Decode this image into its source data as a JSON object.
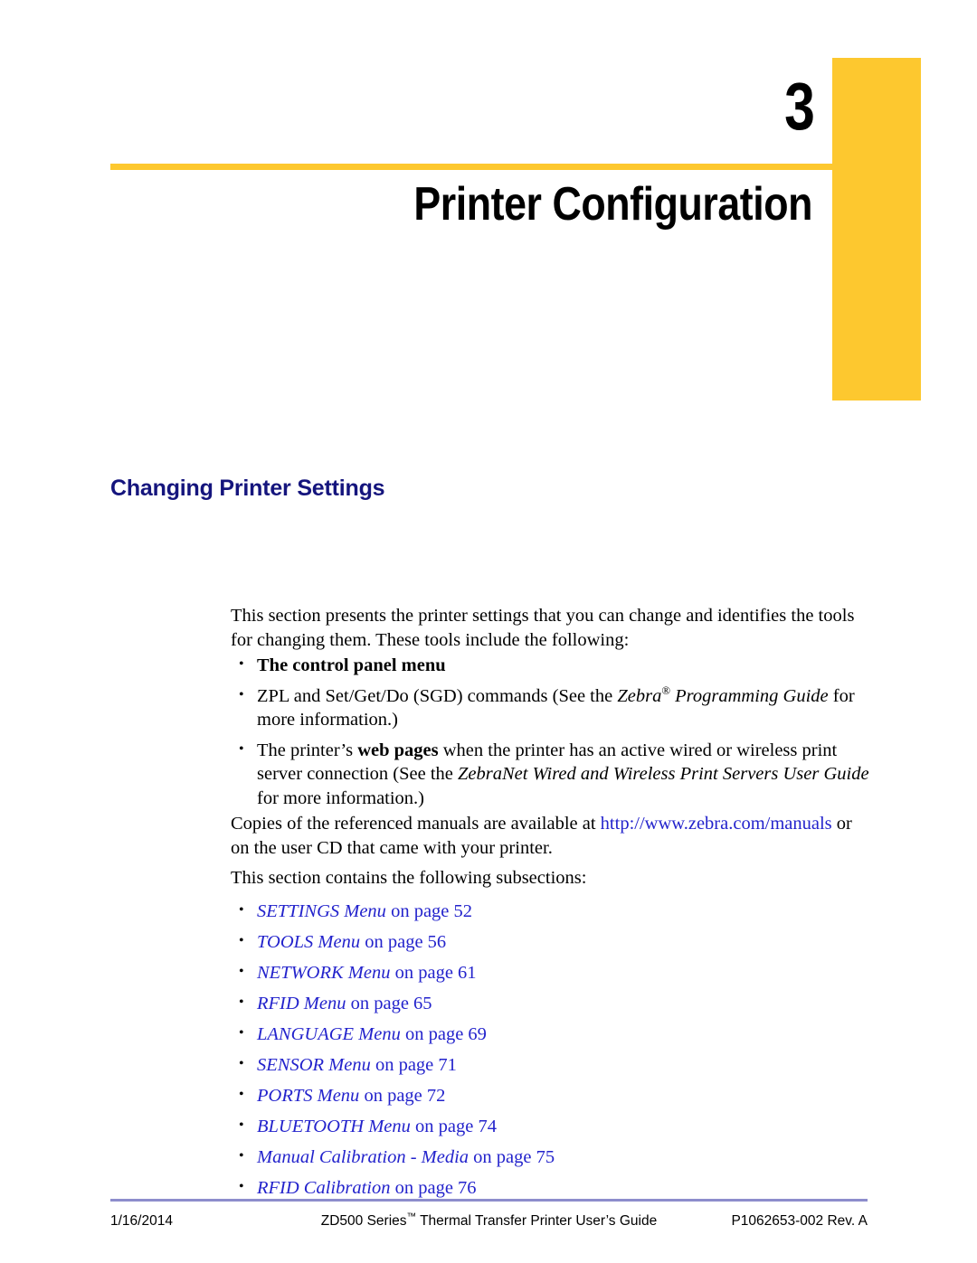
{
  "page": {
    "accent_yellow": "#fdc82f",
    "heading_navy": "#15157d",
    "link_blue": "#2323cc",
    "footer_rule_color": "#8d8dcc"
  },
  "chapter": {
    "number": "3",
    "title": "Printer Configuration"
  },
  "section": {
    "heading": "Changing Printer Settings",
    "intro": "This section presents the printer settings that you can change and identifies the tools for changing them. These tools include the following:",
    "tools": [
      {
        "id": "control-panel-menu",
        "bold_lead": "The control panel menu",
        "rest": ""
      },
      {
        "id": "zpl-sgd-commands",
        "pre": "ZPL and Set/Get/Do (SGD) commands (See the ",
        "italic_title": "Zebra",
        "registered": "®",
        "italic_title_2": " Programming Guide",
        "post": " for more information.)"
      },
      {
        "id": "web-pages",
        "pre": "The printer’s ",
        "bold": "web pages",
        "mid": " when the printer has an active wired or wireless print server connection (See the ",
        "italic_title": "ZebraNet Wired and Wireless Print Servers User Guide",
        "post": " for more information.)"
      }
    ],
    "copies_pre": "Copies of the referenced manuals are available at ",
    "copies_link": "http://www.zebra.com/manuals",
    "copies_post": " or on the user CD that came with your printer.",
    "subsections_intro": "This section contains the following subsections:",
    "subsections": [
      {
        "title": "SETTINGS Menu",
        "page_text": " on page 52"
      },
      {
        "title": "TOOLS Menu",
        "page_text": " on page 56"
      },
      {
        "title": "NETWORK Menu",
        "page_text": " on page 61"
      },
      {
        "title": "RFID Menu",
        "page_text": " on page 65"
      },
      {
        "title": "LANGUAGE Menu",
        "page_text": " on page 69"
      },
      {
        "title": "SENSOR Menu",
        "page_text": " on page 71"
      },
      {
        "title": "PORTS Menu",
        "page_text": " on page 72"
      },
      {
        "title": "BLUETOOTH Menu",
        "page_text": " on page 74"
      },
      {
        "title": "Manual Calibration - Media",
        "page_text": " on page 75"
      },
      {
        "title": "RFID Calibration",
        "page_text": " on page 76"
      }
    ]
  },
  "footer": {
    "date": "1/16/2014",
    "title_pre": "ZD500 Series",
    "title_tm": "™",
    "title_post": " Thermal Transfer Printer User’s Guide",
    "doc_number": "P1062653-002 Rev. A"
  }
}
